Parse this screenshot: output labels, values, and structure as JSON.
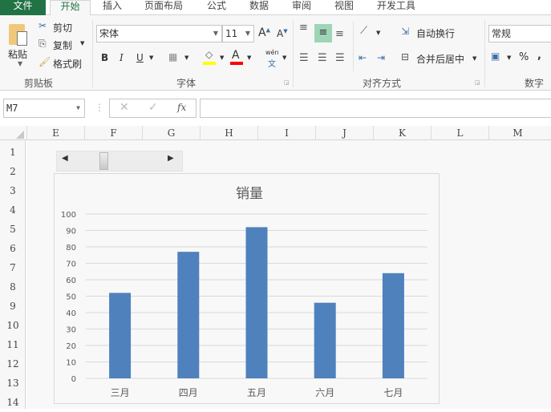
{
  "tabs": [
    "文件",
    "开始",
    "插入",
    "页面布局",
    "公式",
    "数据",
    "审阅",
    "视图",
    "开发工具"
  ],
  "clipboard": {
    "paste": "粘贴",
    "cut": "剪切",
    "copy": "复制",
    "format_painter": "格式刷",
    "group": "剪贴板"
  },
  "font": {
    "name": "宋体",
    "size": "11",
    "bold": "B",
    "italic": "I",
    "underline": "U",
    "phonetic": "wén",
    "phonetic_char": "文",
    "group": "字体",
    "fill_color": "#ffff00",
    "font_color": "#ff0000"
  },
  "alignment": {
    "wrap": "自动换行",
    "merge": "合并后居中",
    "group": "对齐方式"
  },
  "number": {
    "format": "常规",
    "percent": "%",
    "comma": ",",
    "group": "数字"
  },
  "formula_bar": {
    "name_box": "M7",
    "fx": "fx",
    "value": ""
  },
  "columns": [
    "E",
    "F",
    "G",
    "H",
    "I",
    "J",
    "K",
    "L",
    "M"
  ],
  "rows": [
    "1",
    "2",
    "3",
    "4",
    "5",
    "6",
    "7",
    "8",
    "9",
    "10",
    "11",
    "12",
    "13",
    "14"
  ],
  "chart_data": {
    "type": "bar",
    "title": "销量",
    "categories": [
      "三月",
      "四月",
      "五月",
      "六月",
      "七月"
    ],
    "values": [
      52,
      77,
      92,
      46,
      64
    ],
    "ylim": [
      0,
      100
    ],
    "yticks": [
      "0",
      "10",
      "20",
      "30",
      "40",
      "50",
      "60",
      "70",
      "80",
      "90",
      "100"
    ],
    "grid": true,
    "color": "#4f81bd",
    "xlabel": "",
    "ylabel": ""
  }
}
